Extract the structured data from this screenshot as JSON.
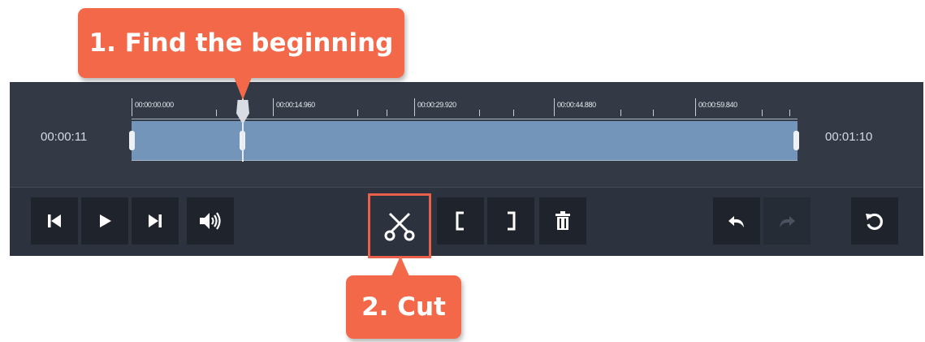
{
  "callouts": {
    "step1": "1. Find the beginning",
    "step2": "2. Cut"
  },
  "timeline": {
    "time_left": "00:00:11",
    "time_right": "00:01:10",
    "ruler_labels": [
      "00:00:00.000",
      "00:00:14.960",
      "00:00:29.920",
      "00:00:44.880",
      "00:00:59.840"
    ]
  },
  "toolbar": {
    "buttons": [
      {
        "name": "skip-to-start-icon"
      },
      {
        "name": "play-icon"
      },
      {
        "name": "skip-to-end-icon"
      },
      {
        "name": "volume-icon"
      },
      {
        "name": "scissors-icon"
      },
      {
        "name": "mark-in-icon"
      },
      {
        "name": "mark-out-icon"
      },
      {
        "name": "trash-icon"
      },
      {
        "name": "undo-icon"
      },
      {
        "name": "redo-icon"
      },
      {
        "name": "reset-icon"
      }
    ]
  },
  "colors": {
    "callout": "#f4684a",
    "panel": "#2c333f",
    "clip": "#7395ba",
    "cut_highlight": "#e8604a"
  }
}
